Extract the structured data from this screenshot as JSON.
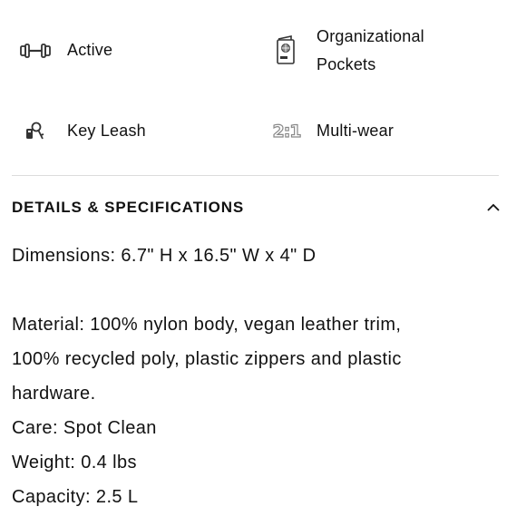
{
  "features": [
    {
      "icon": "dumbbell-icon",
      "label": "Active"
    },
    {
      "icon": "passport-icon",
      "label": "Organizational Pockets"
    },
    {
      "icon": "keys-icon",
      "label": "Key Leash"
    },
    {
      "icon": "two-in-one-icon",
      "label": "Multi-wear",
      "icon_text": "2:1"
    }
  ],
  "details": {
    "title": "DETAILS & SPECIFICATIONS",
    "expanded": true,
    "dimensions": "Dimensions: 6.7\" H x 16.5\" W x 4\" D",
    "material_lines": [
      "Material: 100% nylon body, vegan leather trim,",
      "100% recycled poly, plastic zippers and plastic",
      "hardware."
    ],
    "care": "Care: Spot Clean",
    "weight": "Weight: 0.4 lbs",
    "capacity": "Capacity: 2.5 L"
  },
  "colors": {
    "text": "#111111",
    "divider": "#dcdcdc",
    "icon": "#333333"
  }
}
